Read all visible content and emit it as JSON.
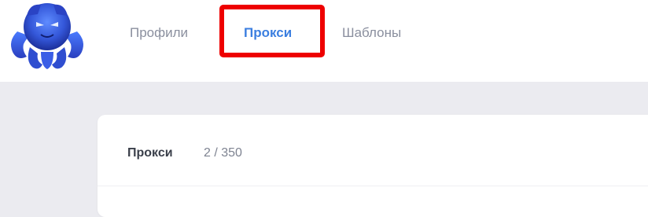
{
  "nav": {
    "tabs": [
      {
        "label": "Профили",
        "active": false
      },
      {
        "label": "Прокси",
        "active": true
      },
      {
        "label": "Шаблоны",
        "active": false
      }
    ]
  },
  "logo": {
    "icon": "octopus-mascot-icon"
  },
  "card": {
    "title": "Прокси",
    "count": "2 / 350"
  },
  "colors": {
    "active_tab": "#3c7fe0",
    "inactive_tab": "#8a8f9e",
    "highlight": "#ee0000",
    "page_bg": "#ebebf0"
  }
}
